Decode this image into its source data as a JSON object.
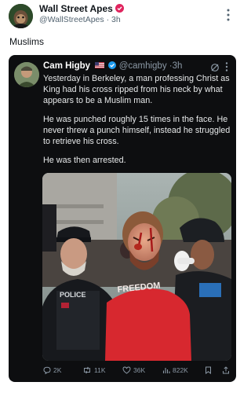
{
  "post": {
    "author_name": "Wall Street Apes",
    "author_handle": "@WallStreetApes",
    "separator": "·",
    "time": "3h",
    "text": "Muslims"
  },
  "quote": {
    "author_name": "Cam Higby",
    "author_handle": "@camhigby",
    "separator": "·",
    "time": "3h",
    "paragraphs": [
      "Yesterday in Berkeley, a man professing Christ as King had his cross ripped from his neck by what appears to be a Muslim man.",
      "He was punched roughly 15 times in the face. He never threw a punch himself, instead he struggled to retrieve his cross.",
      "He was then arrested."
    ],
    "image": {
      "shirt_text": "FREEDOM",
      "vest_text": "POLICE"
    },
    "stats": {
      "replies": "2K",
      "reposts": "11K",
      "likes": "36K",
      "views": "822K"
    }
  },
  "colors": {
    "verified_badge": "#e0245e",
    "blue_check": "#1d9bf0",
    "quote_bg": "#0d0e10",
    "shirt": "#d7282f"
  },
  "icons": [
    "more-icon",
    "verified-badge-icon",
    "us-flag-icon",
    "blue-check-icon",
    "grok-icon",
    "reply-icon",
    "repost-icon",
    "like-icon",
    "views-icon",
    "bookmark-icon",
    "share-icon"
  ]
}
